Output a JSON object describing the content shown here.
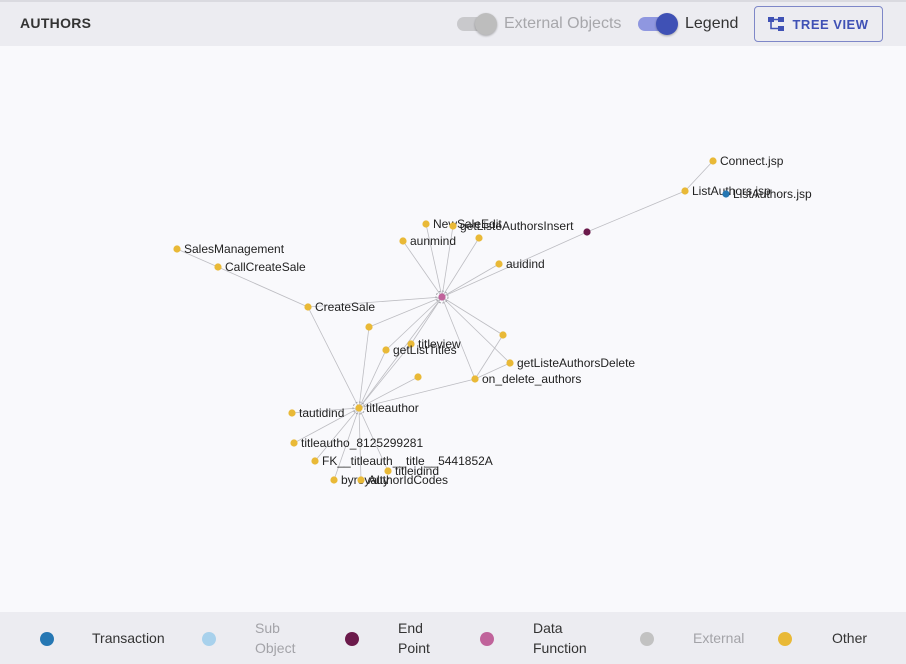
{
  "header": {
    "title": "AUTHORS",
    "external_toggle": {
      "label": "External Objects",
      "on": true,
      "disabled": true
    },
    "legend_toggle": {
      "label": "Legend",
      "on": true
    },
    "tree_view_label": "TREE VIEW"
  },
  "graph": {
    "colors": {
      "Transaction": "#2677b3",
      "Sub Object": "#a8d1ec",
      "End Point": "#6b1a4b",
      "Data Function": "#c0639b",
      "External": "#c2c2c2",
      "Other": "#e9b937"
    },
    "nodes": [
      {
        "id": "center",
        "label": "",
        "type": "Data Function",
        "hub": true
      },
      {
        "id": "titleauthor",
        "label": "titleauthor",
        "type": "Other",
        "hub": true
      },
      {
        "id": "connect",
        "label": "Connect.jsp",
        "type": "Other"
      },
      {
        "id": "listauthors1",
        "label": "ListAuthors.jsp",
        "type": "Other"
      },
      {
        "id": "listauthors2",
        "label": "ListAuthors.jsp",
        "type": "Transaction"
      },
      {
        "id": "endpoint",
        "label": "",
        "type": "End Point"
      },
      {
        "id": "newsale",
        "label": "NewSaleEdit",
        "type": "Other"
      },
      {
        "id": "getlisteinsert",
        "label": "getListeAuthorsInsert",
        "type": "Other"
      },
      {
        "id": "gli_dot",
        "label": "",
        "type": "Other"
      },
      {
        "id": "aunmind",
        "label": "aunmind",
        "type": "Other"
      },
      {
        "id": "auidind",
        "label": "auidind",
        "type": "Other"
      },
      {
        "id": "salesmgmt",
        "label": "SalesManagement",
        "type": "Other"
      },
      {
        "id": "callcreatesale",
        "label": "CallCreateSale",
        "type": "Other"
      },
      {
        "id": "createsale",
        "label": "CreateSale",
        "type": "Other"
      },
      {
        "id": "dotA",
        "label": "",
        "type": "Other"
      },
      {
        "id": "titleview",
        "label": "titleview",
        "type": "Other"
      },
      {
        "id": "getlisttitles",
        "label": "getListTitles",
        "type": "Other"
      },
      {
        "id": "dotB",
        "label": "",
        "type": "Other"
      },
      {
        "id": "getlistedelete",
        "label": "getListeAuthorsDelete",
        "type": "Other"
      },
      {
        "id": "dotC",
        "label": "",
        "type": "Other"
      },
      {
        "id": "ondelete",
        "label": "on_delete_authors",
        "type": "Other"
      },
      {
        "id": "tautidind",
        "label": "tautidind",
        "type": "Other"
      },
      {
        "id": "titleautho",
        "label": "titleautho_8125299281",
        "type": "Other"
      },
      {
        "id": "fk",
        "label": "FK__titleauth__title__5441852A",
        "type": "Other"
      },
      {
        "id": "titleidind",
        "label": "titleidind",
        "type": "Other"
      },
      {
        "id": "byroyalty",
        "label": "byroyalty",
        "type": "Other"
      },
      {
        "id": "authoridcodes",
        "label": "AuthorIdCodes",
        "type": "Other"
      }
    ],
    "edges": [
      [
        "connect",
        "listauthors1"
      ],
      [
        "listauthors1",
        "endpoint"
      ],
      [
        "endpoint",
        "center"
      ],
      [
        "center",
        "newsale"
      ],
      [
        "center",
        "getlisteinsert"
      ],
      [
        "center",
        "gli_dot"
      ],
      [
        "center",
        "aunmind"
      ],
      [
        "center",
        "auidind"
      ],
      [
        "center",
        "createsale"
      ],
      [
        "center",
        "dotA"
      ],
      [
        "center",
        "titleview"
      ],
      [
        "center",
        "getlisttitles"
      ],
      [
        "center",
        "titleauthor"
      ],
      [
        "center",
        "dotB"
      ],
      [
        "center",
        "getlistedelete"
      ],
      [
        "center",
        "ondelete"
      ],
      [
        "dotB",
        "ondelete"
      ],
      [
        "getlistedelete",
        "ondelete"
      ],
      [
        "salesmgmt",
        "callcreatesale"
      ],
      [
        "callcreatesale",
        "createsale"
      ],
      [
        "createsale",
        "titleauthor"
      ],
      [
        "dotA",
        "titleauthor"
      ],
      [
        "titleview",
        "titleauthor"
      ],
      [
        "getlisttitles",
        "titleauthor"
      ],
      [
        "dotC",
        "titleauthor"
      ],
      [
        "ondelete",
        "titleauthor"
      ],
      [
        "titleauthor",
        "tautidind"
      ],
      [
        "titleauthor",
        "titleautho"
      ],
      [
        "titleauthor",
        "fk"
      ],
      [
        "titleauthor",
        "titleidind"
      ],
      [
        "titleauthor",
        "byroyalty"
      ],
      [
        "titleauthor",
        "authoridcodes"
      ]
    ]
  },
  "legend": [
    {
      "label": "Transaction",
      "lines": [
        "Transaction"
      ],
      "color": "#2677b3",
      "muted": false
    },
    {
      "label": "Sub Object",
      "lines": [
        "Sub",
        "Object"
      ],
      "color": "#a8d1ec",
      "muted": true
    },
    {
      "label": "End Point",
      "lines": [
        "End",
        "Point"
      ],
      "color": "#6b1a4b",
      "muted": false
    },
    {
      "label": "Data Function",
      "lines": [
        "Data",
        "Function"
      ],
      "color": "#c0639b",
      "muted": false
    },
    {
      "label": "External",
      "lines": [
        "External"
      ],
      "color": "#c2c2c2",
      "muted": true
    },
    {
      "label": "Other",
      "lines": [
        "Other"
      ],
      "color": "#e9b937",
      "muted": false
    }
  ]
}
